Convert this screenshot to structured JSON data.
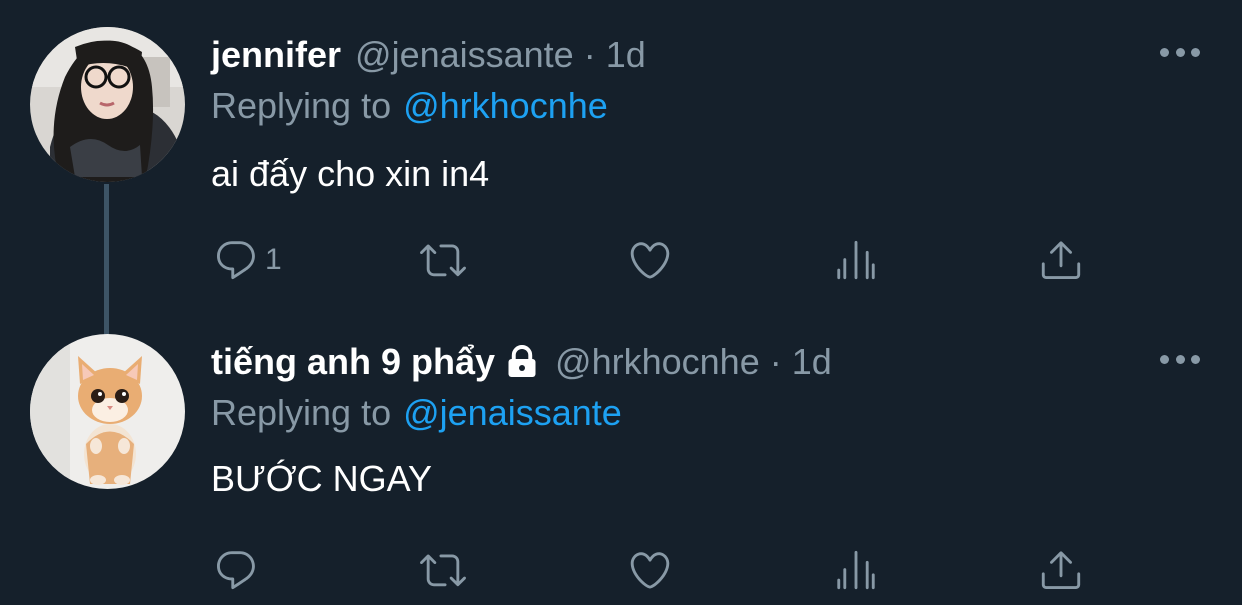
{
  "tweets": [
    {
      "name": "jennifer",
      "handle": "@jenaissante",
      "separator": "·",
      "time": "1d",
      "replying_label": "Replying to",
      "replying_to": "@hrkhocnhe",
      "text": "ai đấy cho xin in4",
      "reply_count": "1",
      "protected": false,
      "avatar": "girl-with-glasses-avatar"
    },
    {
      "name": "tiếng anh 9 phẩy",
      "handle": "@hrkhocnhe",
      "separator": "·",
      "time": "1d",
      "replying_label": "Replying to",
      "replying_to": "@jenaissante",
      "text": "BƯỚC NGAY",
      "reply_count": "",
      "protected": true,
      "avatar": "kitten-avatar"
    }
  ],
  "icons": [
    "reply-icon",
    "retweet-icon",
    "like-icon",
    "analytics-icon",
    "share-icon",
    "more-icon",
    "lock-icon"
  ],
  "colors": {
    "background": "#15202b",
    "primary_text": "#ffffff",
    "secondary_text": "#8899a6",
    "accent": "#1da1f2"
  }
}
